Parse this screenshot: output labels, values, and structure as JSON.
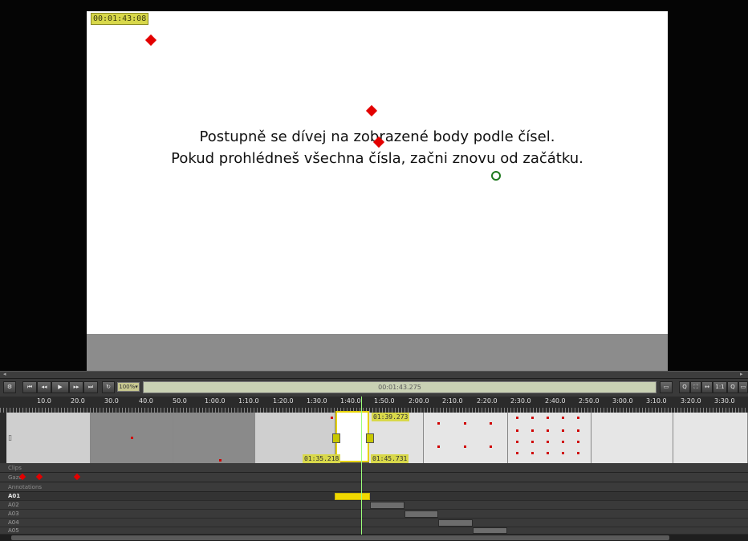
{
  "video": {
    "timecode": "00:01:43:08",
    "slide_lines": [
      "Postupně se dívej na zobrazené body podle čísel.",
      "Pokud prohlédneš všechna čísla, začni znovu od začátku."
    ]
  },
  "transport": {
    "buttons": [
      "⏮",
      "◂◂",
      "▶",
      "▸▸",
      "⏭",
      "↻"
    ],
    "rate": "100%▾",
    "current_time": "00:01:43.275",
    "zoom_buttons": [
      "▭",
      "Q",
      "⛶",
      "↔",
      "1:1",
      "Q",
      "▭"
    ]
  },
  "ruler": {
    "labels": [
      "10.0",
      "20.0",
      "30.0",
      "40.0",
      "50.0",
      "1:00.0",
      "1:10.0",
      "1:20.0",
      "1:30.0",
      "1:40.0",
      "1:50.0",
      "2:00.0",
      "2:10.0",
      "2:20.0",
      "2:30.0",
      "2:40.0",
      "2:50.0",
      "3:00.0",
      "3:10.0",
      "3:20.0",
      "3:30.0"
    ]
  },
  "media_strip": {
    "selection_start": "01:35.218",
    "selection_end": "01:45.731",
    "selected_badge": "01:39.273"
  },
  "tracks": {
    "rows": [
      "Clips",
      "Gaze",
      "Annotations"
    ]
  },
  "aoi": {
    "rows": [
      "A01",
      "A02",
      "A03",
      "A04",
      "A05"
    ]
  },
  "colors": {
    "marker_red": "#e30000",
    "aoi_active": "#f0d800",
    "playhead": "#9bff7a"
  }
}
